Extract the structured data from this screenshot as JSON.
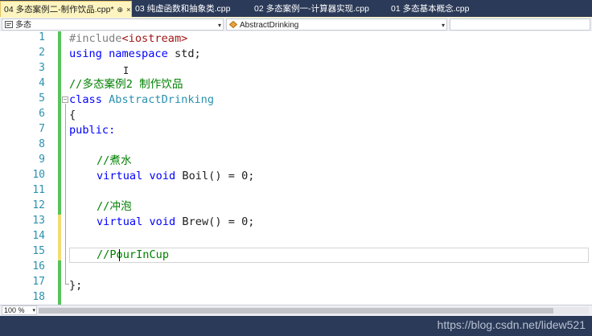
{
  "tabs": [
    {
      "label": "04 多态案例二-制作饮品.cpp*",
      "active": true,
      "pin": "⊕",
      "close": "×"
    },
    {
      "label": "03 纯虚函数和抽象类.cpp",
      "active": false
    },
    {
      "label": "02 多态案例一-计算器实现.cpp",
      "active": false
    },
    {
      "label": "01 多态基本概念.cpp",
      "active": false
    }
  ],
  "nav": {
    "scope_combo": "多态",
    "member_combo": "AbstractDrinking"
  },
  "editor": {
    "line_numbers": [
      "1",
      "2",
      "3",
      "4",
      "5",
      "6",
      "7",
      "8",
      "9",
      "10",
      "11",
      "12",
      "13",
      "14",
      "15",
      "16",
      "17",
      "18"
    ],
    "lines": {
      "l1_pp": "#include",
      "l1_str": "<iostream>",
      "l2_kw1": "using",
      "l2_kw2": "namespace",
      "l2_rest": " std;",
      "l4_comment": "//多态案例2 制作饮品",
      "l5_kw": "class",
      "l5_type": "AbstractDrinking",
      "l6": "{",
      "l7": "public:",
      "l9_comment": "//煮水",
      "l10_kw1": "virtual",
      "l10_kw2": "void",
      "l10_rest": " Boil() = 0;",
      "l12_comment": "//冲泡",
      "l13_kw1": "virtual",
      "l13_kw2": "void",
      "l13_rest": " Brew() = 0;",
      "l15_comment": "//PourInCup",
      "l17": "};"
    },
    "fold_marker": "−"
  },
  "zoom": "100 %",
  "watermark": "https://blog.csdn.net/lidew521",
  "colors": {
    "active_tab": "#fdf4bf",
    "line_number": "#2b91af",
    "keyword": "#0000ff",
    "comment": "#008000",
    "type": "#2b91af",
    "string": "#a31515",
    "saved_change": "#57c45b",
    "unsaved_change": "#f2dc74"
  },
  "icons": {
    "scope_icon": "project-icon",
    "member_icon": "class-icon",
    "dropdown": "chevron-down-icon"
  }
}
